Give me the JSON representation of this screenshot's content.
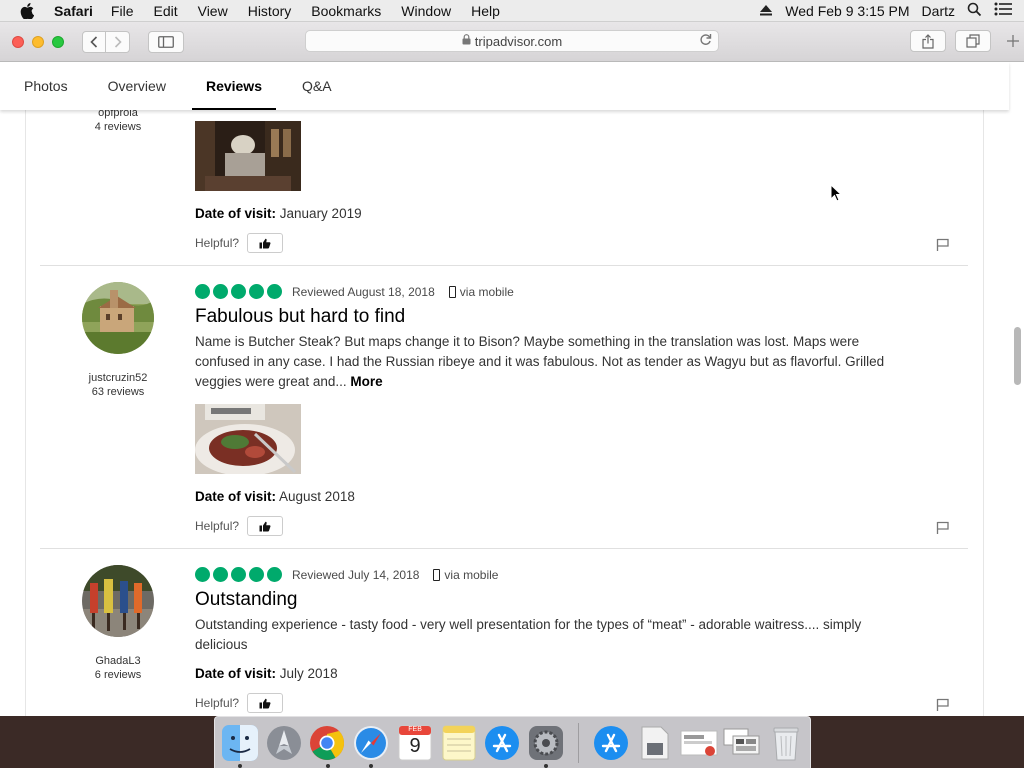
{
  "menubar": {
    "app": "Safari",
    "items": [
      "File",
      "Edit",
      "View",
      "History",
      "Bookmarks",
      "Window",
      "Help"
    ],
    "clock": "Wed Feb 9  3:15 PM",
    "user": "Dartz"
  },
  "browser": {
    "url": "tripadvisor.com"
  },
  "subnav": {
    "tabs": [
      "Photos",
      "Overview",
      "Reviews",
      "Q&A"
    ],
    "active": "Reviews"
  },
  "reviews": [
    {
      "username": "opfprola",
      "review_count": "4 reviews",
      "date_of_visit_label": "Date of visit:",
      "date_of_visit": "January 2019",
      "helpful_label": "Helpful?"
    },
    {
      "username": "justcruzin52",
      "review_count": "63 reviews",
      "rating": 5,
      "reviewed": "Reviewed August 18, 2018",
      "via": "via mobile",
      "title": "Fabulous but hard to find",
      "body": "Name is Butcher Steak? But maps change it to Bison? Maybe something in the translation was lost. Maps were confused in any case. I had the Russian ribeye and it was fabulous. Not as tender as Wagyu but as flavorful. Grilled veggies were great and...",
      "more": "More",
      "date_of_visit_label": "Date of visit:",
      "date_of_visit": "August 2018",
      "helpful_label": "Helpful?"
    },
    {
      "username": "GhadaL3",
      "review_count": "6 reviews",
      "rating": 5,
      "reviewed": "Reviewed July 14, 2018",
      "via": "via mobile",
      "title": "Outstanding",
      "body": "Outstanding experience - tasty food - very well presentation for the types of “meat” - adorable waitress.... simply delicious",
      "date_of_visit_label": "Date of visit:",
      "date_of_visit": "July 2018",
      "helpful_label": "Helpful?"
    }
  ],
  "dock": {
    "apps": [
      "finder-icon",
      "launchpad-icon",
      "chrome-icon",
      "safari-icon",
      "calendar-icon",
      "notes-icon",
      "app-store-icon",
      "system-preferences-icon",
      "app-store-folder-icon",
      "preview-icon",
      "screenshot-icon",
      "screenshots-folder-icon",
      "trash-icon"
    ],
    "calendar_month": "FEB",
    "calendar_day": "9"
  },
  "colors": {
    "bubble_green": "#00aa6c"
  }
}
